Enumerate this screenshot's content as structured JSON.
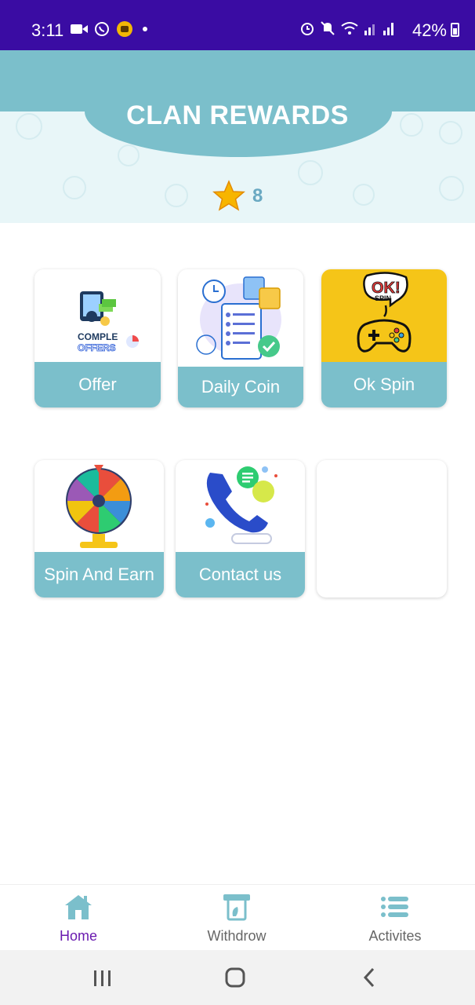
{
  "status_bar": {
    "time": "3:11",
    "battery": "42%"
  },
  "header": {
    "title": "CLAN REWARDS",
    "coins": "8"
  },
  "cards": [
    {
      "label": "Offer",
      "image_text_1": "COMPLE",
      "image_text_2": "OFFERS"
    },
    {
      "label": "Daily Coin"
    },
    {
      "label": "Ok Spin",
      "image_text_1": "OK!",
      "image_text_2": "SPIN"
    },
    {
      "label": "Spin And Earn"
    },
    {
      "label": "Contact us"
    },
    {
      "label": ""
    }
  ],
  "bottom_nav": {
    "items": [
      {
        "label": "Home",
        "icon": "home-icon",
        "active": true
      },
      {
        "label": "Withdrow",
        "icon": "withdraw-icon",
        "active": false
      },
      {
        "label": "Activites",
        "icon": "list-icon",
        "active": false
      }
    ]
  },
  "colors": {
    "status_bar": "#3a0ca3",
    "accent": "#7bbfcb",
    "active_nav": "#6a1bb0"
  }
}
